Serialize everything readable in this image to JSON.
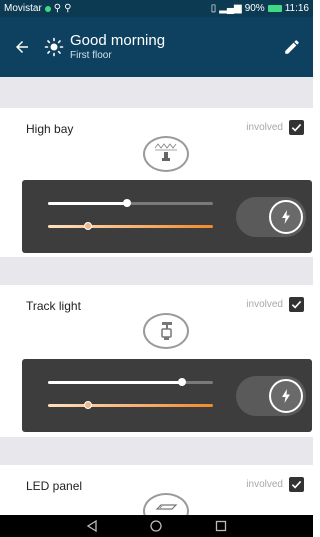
{
  "status": {
    "carrier": "Movistar",
    "battery": "90%",
    "time": "11:16"
  },
  "header": {
    "title": "Good morning",
    "subtitle": "First floor"
  },
  "lights": [
    {
      "name": "High bay",
      "involved_label": "involved",
      "involved": true,
      "icon": "high-bay-lamp-icon",
      "brightness": 0.48,
      "color_temp": 0.24,
      "power": "on"
    },
    {
      "name": "Track light",
      "involved_label": "involved",
      "involved": true,
      "icon": "track-light-icon",
      "brightness": 0.81,
      "color_temp": 0.24,
      "power": "on"
    },
    {
      "name": "LED panel",
      "involved_label": "involved",
      "involved": true,
      "icon": "led-panel-icon"
    }
  ],
  "colors": {
    "appbar": "#0e4160",
    "statusbar": "#0b3a52",
    "panel": "#3d3d3d",
    "temp_slider": "#f08a2c"
  }
}
